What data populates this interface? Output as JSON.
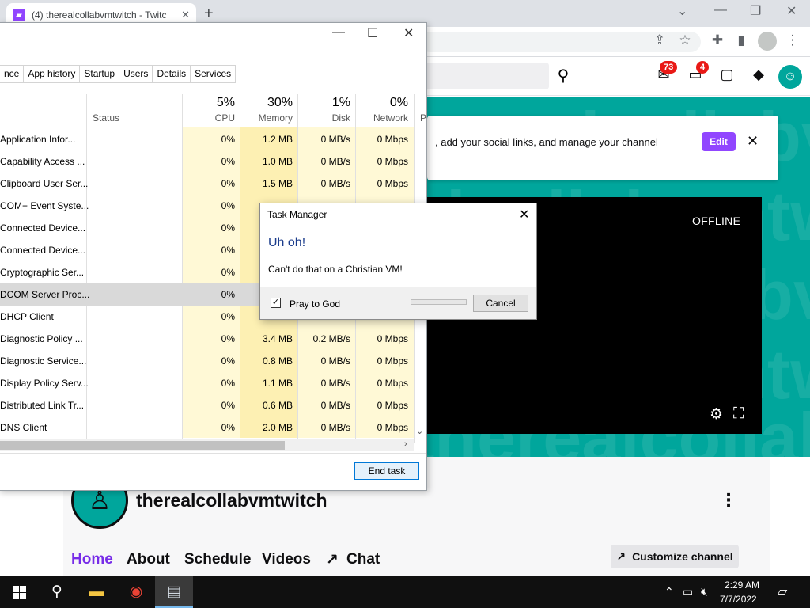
{
  "browser": {
    "tab_title": "(4) therealcollabvmtwitch - Twitc",
    "new_tab": "+",
    "tab_close": "✕",
    "window_controls": [
      "⌄",
      "—",
      "❐",
      "✕"
    ]
  },
  "twitch": {
    "badges": {
      "inbox": "73",
      "notifications": "4"
    },
    "banner_text": ", add your social links, and manage your channel",
    "edit_label": "Edit",
    "banner_close": "✕",
    "offline_label": "OFFLINE",
    "watermark_text": "therealcollabvmtwitch",
    "channel_name": "therealcollabvmtwitch",
    "channel_tabs": [
      "Home",
      "About",
      "Schedule",
      "Videos",
      "Chat"
    ],
    "customize_label": "Customize channel",
    "accent": "#9146ff",
    "teal": "#00a69c"
  },
  "task_manager": {
    "tabs": [
      "nce",
      "App history",
      "Startup",
      "Users",
      "Details",
      "Services"
    ],
    "columns": {
      "status": "Status",
      "cpu": {
        "pct": "5%",
        "label": "CPU"
      },
      "memory": {
        "pct": "30%",
        "label": "Memory"
      },
      "disk": {
        "pct": "1%",
        "label": "Disk"
      },
      "network": {
        "pct": "0%",
        "label": "Network"
      },
      "power": "P"
    },
    "rows": [
      {
        "name": "Application Infor...",
        "cpu": "0%",
        "memory": "1.2 MB",
        "disk": "0 MB/s",
        "network": "0 Mbps"
      },
      {
        "name": "Capability Access ...",
        "cpu": "0%",
        "memory": "1.0 MB",
        "disk": "0 MB/s",
        "network": "0 Mbps"
      },
      {
        "name": "Clipboard User Ser...",
        "cpu": "0%",
        "memory": "1.5 MB",
        "disk": "0 MB/s",
        "network": "0 Mbps"
      },
      {
        "name": "COM+ Event Syste...",
        "cpu": "0%",
        "memory": "",
        "disk": "",
        "network": ""
      },
      {
        "name": "Connected Device...",
        "cpu": "0%",
        "memory": "",
        "disk": "",
        "network": ""
      },
      {
        "name": "Connected Device...",
        "cpu": "0%",
        "memory": "",
        "disk": "",
        "network": ""
      },
      {
        "name": "Cryptographic Ser...",
        "cpu": "0%",
        "memory": "",
        "disk": "",
        "network": ""
      },
      {
        "name": "DCOM Server Proc...",
        "cpu": "0%",
        "memory": "",
        "disk": "",
        "network": ""
      },
      {
        "name": "DHCP Client",
        "cpu": "0%",
        "memory": "",
        "disk": "",
        "network": ""
      },
      {
        "name": "Diagnostic Policy ...",
        "cpu": "0%",
        "memory": "3.4 MB",
        "disk": "0.2 MB/s",
        "network": "0 Mbps"
      },
      {
        "name": "Diagnostic Service...",
        "cpu": "0%",
        "memory": "0.8 MB",
        "disk": "0 MB/s",
        "network": "0 Mbps"
      },
      {
        "name": "Display Policy Serv...",
        "cpu": "0%",
        "memory": "1.1 MB",
        "disk": "0 MB/s",
        "network": "0 Mbps"
      },
      {
        "name": "Distributed Link Tr...",
        "cpu": "0%",
        "memory": "0.6 MB",
        "disk": "0 MB/s",
        "network": "0 Mbps"
      },
      {
        "name": "DNS Client",
        "cpu": "0%",
        "memory": "2.0 MB",
        "disk": "0 MB/s",
        "network": "0 Mbps"
      }
    ],
    "end_task_label": "End task"
  },
  "dialog": {
    "title": "Task Manager",
    "heading": "Uh oh!",
    "message": "Can't do that on a Christian VM!",
    "checkbox_label": "Pray to God",
    "checkbox_mark": "✓",
    "cancel_label": "Cancel",
    "close": "✕"
  },
  "taskbar": {
    "time": "2:29 AM",
    "date": "7/7/2022"
  }
}
